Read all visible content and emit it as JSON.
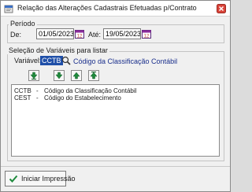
{
  "window": {
    "title": "Relação das Alterações Cadastrais Efetuadas p/Contrato"
  },
  "periodo": {
    "group_title": "Período",
    "de_label": "De:",
    "de_value": "01/05/2023",
    "ate_label": "Até:",
    "ate_value": "19/05/2023"
  },
  "selecao": {
    "group_title": "Seleção de Variáveis para listar",
    "variavel_label": "Variável:",
    "variavel_value": "CCTB",
    "variavel_desc": "Código da Classificação Contábil",
    "items": [
      {
        "code": "CCTB",
        "sep": "-",
        "desc": "Código da Classificação Contábil"
      },
      {
        "code": "CEST",
        "sep": "-",
        "desc": "Código do Estabelecimento"
      }
    ]
  },
  "footer": {
    "print_label": "Iniciar Impressão"
  },
  "colors": {
    "accent": "#1f4fa8",
    "arrow_green": "#1e8a3c",
    "close_red": "#c0392b"
  },
  "icons": [
    "app-icon",
    "close-icon",
    "calendar-icon",
    "search-icon",
    "arrow-down-icon",
    "arrow-up-icon",
    "check-icon"
  ]
}
